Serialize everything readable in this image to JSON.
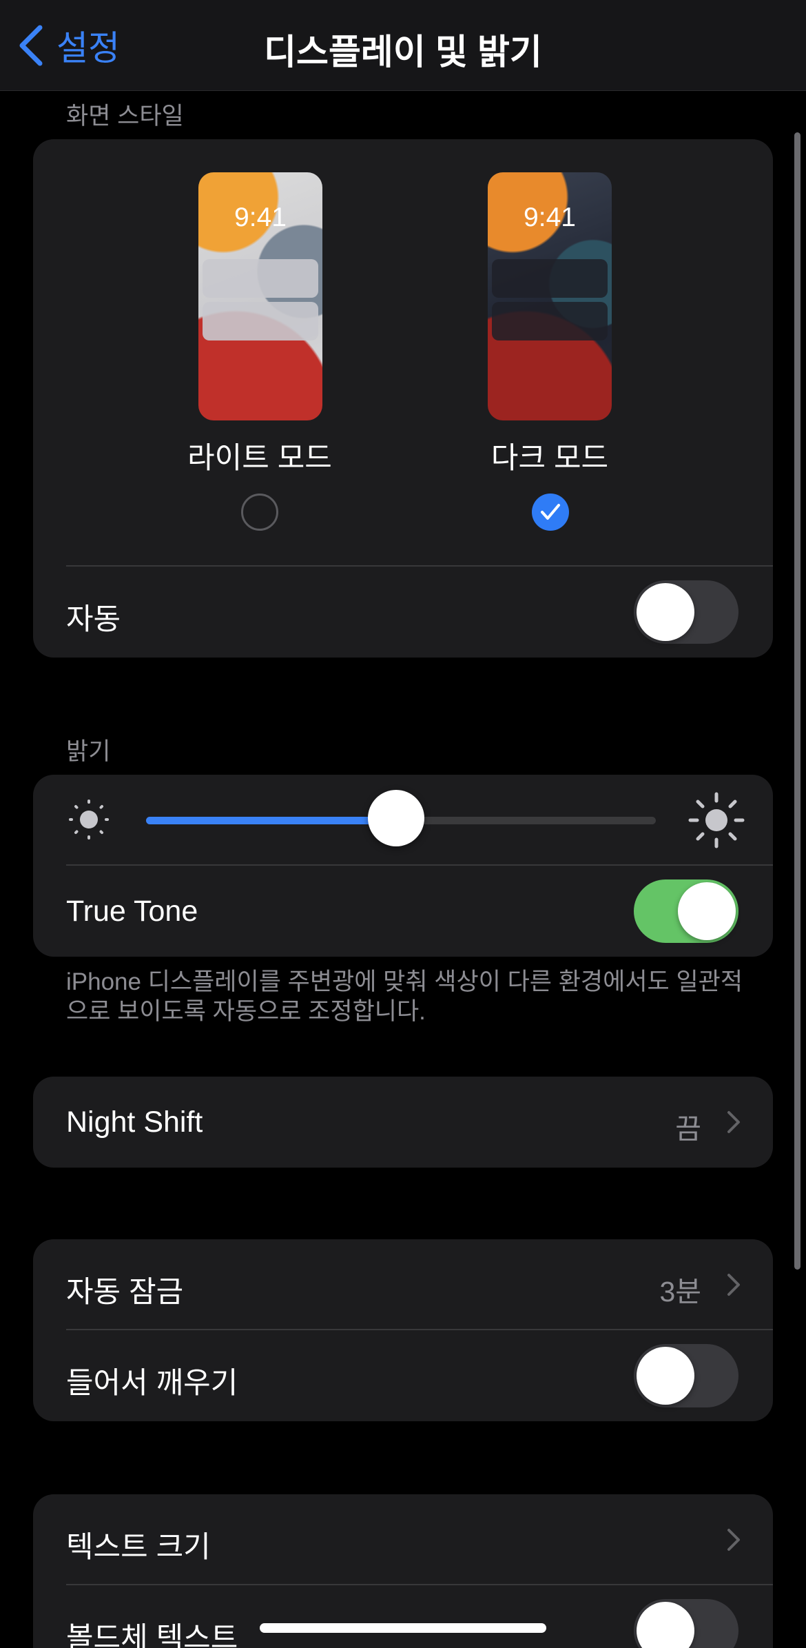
{
  "nav": {
    "back_label": "설정",
    "title": "디스플레이 및 밝기"
  },
  "appearance": {
    "header": "화면 스타일",
    "light": {
      "time": "9:41",
      "label": "라이트 모드",
      "selected": false
    },
    "dark": {
      "time": "9:41",
      "label": "다크 모드",
      "selected": true
    },
    "auto": {
      "label": "자동",
      "on": false
    }
  },
  "brightness": {
    "header": "밝기",
    "level": 0.49,
    "true_tone": {
      "label": "True Tone",
      "on": true
    },
    "footer": "iPhone 디스플레이를 주변광에 맞춰 색상이 다른 환경에서도 일관적으로 보이도록 자동으로 조정합니다."
  },
  "night_shift": {
    "label": "Night Shift",
    "value": "끔"
  },
  "lock": {
    "auto_lock": {
      "label": "자동 잠금",
      "value": "3분"
    },
    "raise_to_wake": {
      "label": "들어서 깨우기",
      "on": false
    }
  },
  "text": {
    "text_size": {
      "label": "텍스트 크기"
    },
    "bold_text": {
      "label": "볼드체 텍스트",
      "on": false
    }
  },
  "colors": {
    "accent": "#3a82f7",
    "toggle_on": "#64c466",
    "toggle_off": "#39393d",
    "card": "#1c1c1e",
    "secondary_text": "#8d8d93"
  }
}
